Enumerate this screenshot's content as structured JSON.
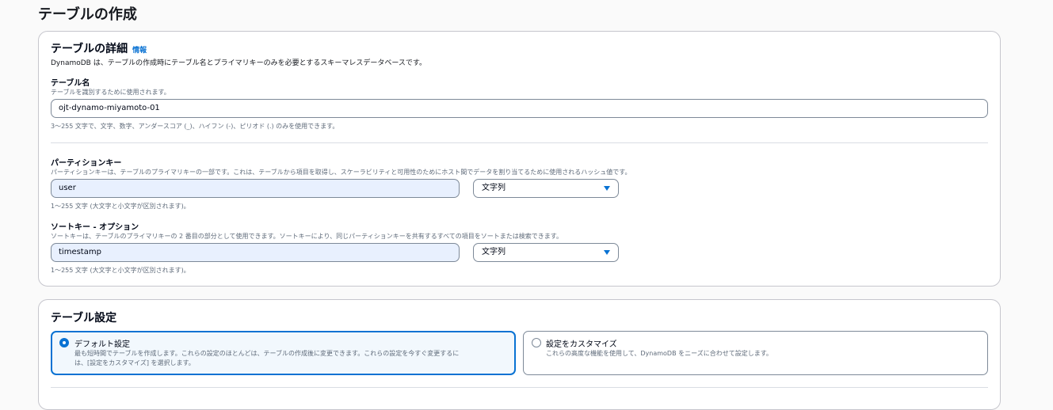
{
  "page": {
    "title": "テーブルの作成"
  },
  "details": {
    "heading": "テーブルの詳細",
    "info_link": "情報",
    "description": "DynamoDB は、テーブルの作成時にテーブル名とプライマリキーのみを必要とするスキーマレスデータベースです。",
    "table_name": {
      "label": "テーブル名",
      "description": "テーブルを識別するために使用されます。",
      "value": "ojt-dynamo-miyamoto-01",
      "constraint": "3～255 文字で、文字、数字、アンダースコア (_)、ハイフン (-)、ピリオド (.) のみを使用できます。"
    },
    "partition_key": {
      "label": "パーティションキー",
      "description": "パーティションキーは、テーブルのプライマリキーの一部です。これは、テーブルから項目を取得し、スケーラビリティと可用性のためにホスト間でデータを割り当てるために使用されるハッシュ値です。",
      "value": "user",
      "type": "文字列",
      "constraint": "1～255 文字 (大文字と小文字が区別されます)。"
    },
    "sort_key": {
      "label": "ソートキー - オプション",
      "description": "ソートキーは、テーブルのプライマリキーの 2 番目の部分として使用できます。ソートキーにより、同じパーティションキーを共有するすべての項目をソートまたは検索できます。",
      "value": "timestamp",
      "type": "文字列",
      "constraint": "1～255 文字 (大文字と小文字が区別されます)。"
    }
  },
  "settings": {
    "heading": "テーブル設定",
    "options": [
      {
        "title": "デフォルト設定",
        "description_line1": "最も短時間でテーブルを作成します。これらの設定のほとんどは、テーブルの作成後に変更できます。これらの設定を今すぐ変更するに",
        "description_line2": "は、[設定をカスタマイズ] を選択します。",
        "selected": true
      },
      {
        "title": "設定をカスタマイズ",
        "description_line1": "これらの高度な機能を使用して、DynamoDB をニーズに合わせて設定します。",
        "description_line2": "",
        "selected": false
      }
    ]
  },
  "colors": {
    "accent": "#0972d3",
    "border": "#7d8998",
    "filled_input": "#e8f0fe"
  }
}
